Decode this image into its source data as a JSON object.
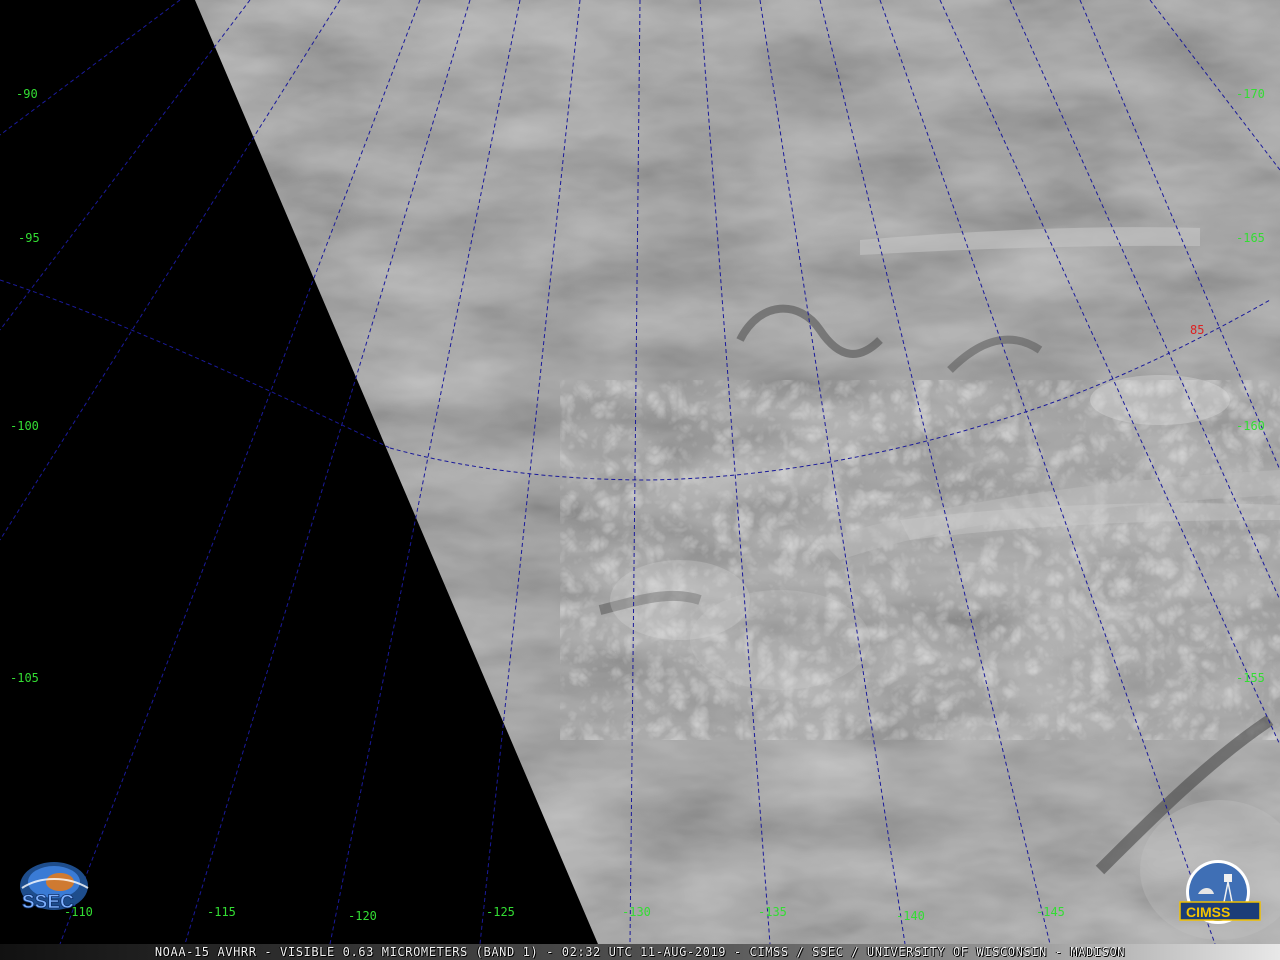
{
  "caption": "NOAA-15 AVHRR - VISIBLE  0.63 MICROMETERS (BAND 1) - 02:32 UTC 11-AUG-2019 - CIMSS / SSEC / UNIVERSITY OF WISCONSIN - MADISON",
  "colors": {
    "longitude_label": "#33dd33",
    "latitude_label": "#dd2222",
    "grid_line": "#1a1a9a",
    "no_data": "#000000"
  },
  "longitude_labels": {
    "left": [
      "-90",
      "-95",
      "-100",
      "-105"
    ],
    "bottom": [
      "-110",
      "-115",
      "-120",
      "-125",
      "-130",
      "-135",
      "-140",
      "-145"
    ],
    "right": [
      "-170",
      "-165",
      "-160",
      "-155"
    ]
  },
  "latitude_labels": [
    "85"
  ],
  "logos": {
    "left": {
      "text": "SSEC",
      "icon": "ssec-logo-icon"
    },
    "right": {
      "text": "CIMSS",
      "icon": "cimss-logo-icon"
    }
  }
}
